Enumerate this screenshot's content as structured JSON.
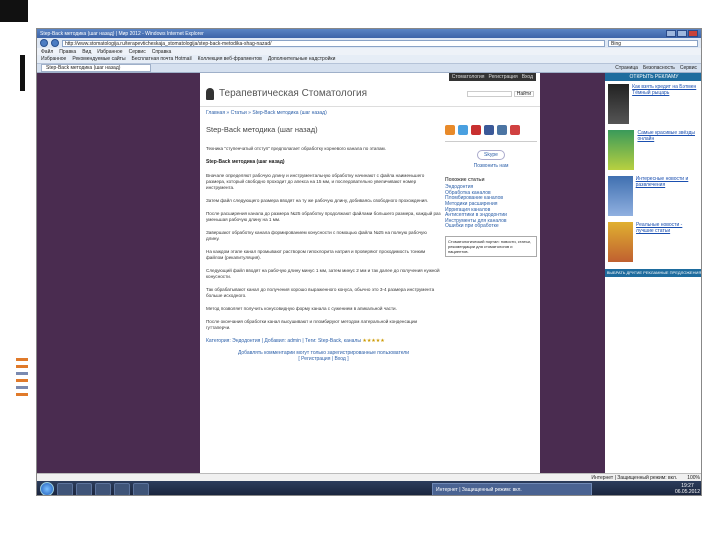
{
  "browser": {
    "window_title": "Step-Back методика (шаг назад) | Мир 2012 - Windows Internet Explorer",
    "address": "http://www.stomatologija.ru/terapevticheskaja_stomatologija/step-back-metodika-shag-nazad/",
    "search_placeholder": "Bing",
    "menu": [
      "Файл",
      "Правка",
      "Вид",
      "Избранное",
      "Сервис",
      "Справка"
    ],
    "favorites": [
      "Избранное",
      "Рекомендуемые сайты",
      "Бесплатная почта Hotmail",
      "Коллекция веб-фрагментов",
      "Дополнительные надстройки"
    ],
    "tab_label": "Step-Back методика (шаг назад)",
    "tools": [
      "Страница",
      "Безопасность",
      "Сервис"
    ],
    "status": "Интернет | Защищенный режим: вкл.",
    "zoom": "100%",
    "task_label": "Интернет | Защищенный режим: вкл.",
    "clock_time": "19:27",
    "clock_date": "06.05.2012"
  },
  "site": {
    "topnav": [
      "Стоматология",
      "Регистрация",
      "Вход"
    ],
    "title": "Терапевтическая Стоматология",
    "search_btn": "Найти",
    "breadcrumbs": "Главная » Статьи » Step-Back методика (шаг назад)",
    "article_title": "Step-Back методика (шаг назад)",
    "subhead": "Step-Back методика (шаг назад)",
    "paragraphs": [
      "Техника \"ступенчатый отступ\" предполагает обработку корневого канала по этапам.",
      "Вначале определяют рабочую длину и инструментальную обработку начинают с файла наименьшего размера, который свободно проходит до апекса на 15 мм, и последовательно увеличивают номер инструмента.",
      "Затем файл следующего размера вводят на ту же рабочую длину, добиваясь свободного прохождения.",
      "После расширения канала до размера №25 обработку продолжают файлами большего размера, каждый раз уменьшая рабочую длину на 1 мм.",
      "Завершают обработку канала формированием конусности с помощью файла №25 на полную рабочую длину.",
      "На каждом этапе канал промывают раствором гипохлорита натрия и проверяют проходимость тонким файлом (рекапитуляция).",
      "Следующий файл вводят на рабочую длину минус 1 мм, затем минус 2 мм и так далее до получения нужной конусности.",
      "Так обрабатывают канал до получения хорошо выраженного конуса, обычно это 3-4 размера инструмента больше исходного.",
      "Метод позволяет получить конусовидную форму канала с сужением в апикальной части.",
      "После окончания обработки канал высушивают и пломбируют методом латеральной конденсации гуттаперчи."
    ],
    "tags": "Категория: Эндодонтия | Добавил: admin | Теги: Step-Back, каналы",
    "rating": "★★★★★",
    "bottom_link1": "Добавлять комментарии могут только зарегистрированные пользователи",
    "bottom_link2": "[ Регистрация | Вход ]",
    "skype": "Skype",
    "skype_link": "Позвонить нам",
    "sidebar_heading": "Похожие статьи",
    "sidebar_items": [
      "Эндодонтия",
      "Обработка каналов",
      "Пломбирование каналов",
      "Методики расширения",
      "Ирригация каналов",
      "Антисептики в эндодонтии",
      "Инструменты для каналов",
      "Ошибки при обработке"
    ],
    "ad_text": "Стоматологический портал: новости, статьи, рекомендации для стоматологов и пациентов."
  },
  "ads": {
    "head": "ОТКРЫТЬ РЕКЛАМУ",
    "items": [
      "Как взять кредит на Бэтмен Тёмный рыцарь",
      "Самые красивые звёзды онлайн",
      "Интересные новости и развлечения",
      "Реальные новости - лучшие статьи"
    ],
    "footer": "ВЫБРАТЬ ДРУГИЕ РЕКЛАМНЫЕ ПРЕДЛОЖЕНИЯ"
  }
}
